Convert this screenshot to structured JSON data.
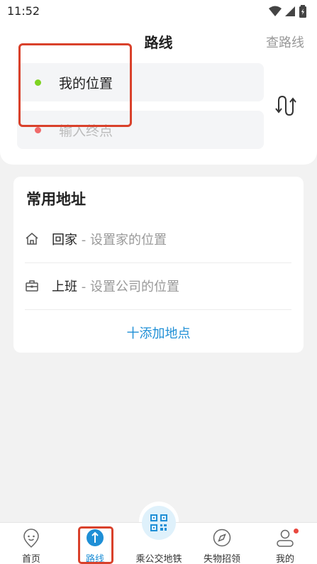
{
  "status_bar": {
    "time": "11:52"
  },
  "header": {
    "title": "路线",
    "action": "查路线"
  },
  "route": {
    "from": {
      "label": "我的位置",
      "dot_color": "#7ed321"
    },
    "to": {
      "placeholder": "输入终点",
      "dot_color": "#f06a6a"
    }
  },
  "addresses": {
    "title": "常用地址",
    "items": [
      {
        "name": "回家",
        "separator": " - ",
        "hint": "设置家的位置",
        "icon": "home-icon"
      },
      {
        "name": "上班",
        "separator": " - ",
        "hint": "设置公司的位置",
        "icon": "briefcase-icon"
      }
    ],
    "add_label": "十添加地点"
  },
  "tabs": [
    {
      "label": "首页",
      "icon": "location-pin-icon"
    },
    {
      "label": "路线",
      "icon": "route-compass-icon",
      "active": true
    },
    {
      "label": "乘公交地铁",
      "icon": "qr-code-icon"
    },
    {
      "label": "失物招领",
      "icon": "compass-icon"
    },
    {
      "label": "我的",
      "icon": "user-icon",
      "badge": true
    }
  ],
  "colors": {
    "accent": "#1f8fd6",
    "highlight": "#d9412b",
    "badge": "#e9483f"
  }
}
